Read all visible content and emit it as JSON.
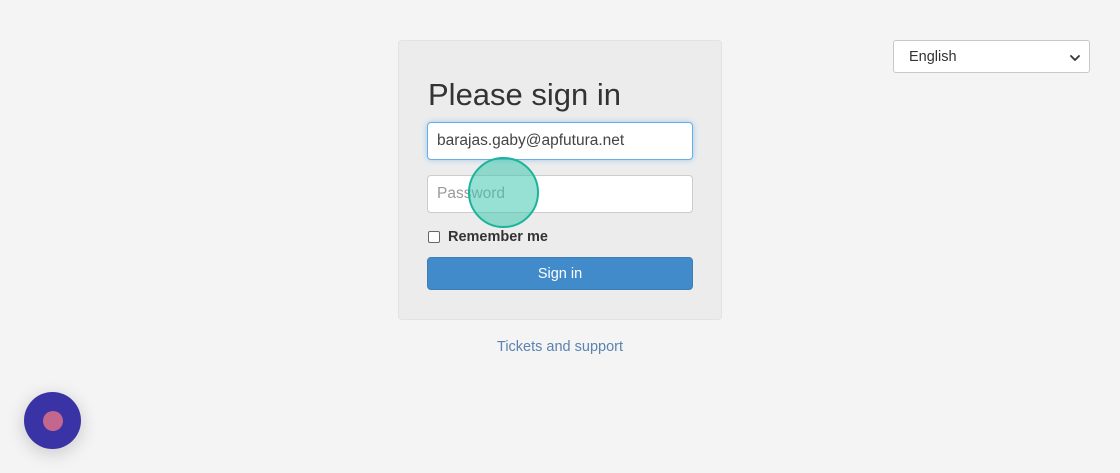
{
  "login": {
    "title": "Please sign in",
    "email_value": "barajas.gaby@apfutura.net",
    "password_placeholder": "Password",
    "remember_label": "Remember me",
    "signin_label": "Sign in"
  },
  "footer": {
    "support_link": "Tickets and support"
  },
  "language": {
    "selected": "English",
    "icon": "chevron-down-icon"
  },
  "widgets": {
    "click_indicator_icon": "click-ring-icon",
    "chat_icon": "chat-bubble-icon"
  },
  "colors": {
    "background": "#f4f4f4",
    "card": "#ececec",
    "primary_button": "#428bca",
    "focus_border": "#66afe9",
    "link": "#5b83ad",
    "click_ring": "#1bb39a",
    "chat_bubble": "#3a33a6",
    "chat_dot": "#c4678e"
  }
}
